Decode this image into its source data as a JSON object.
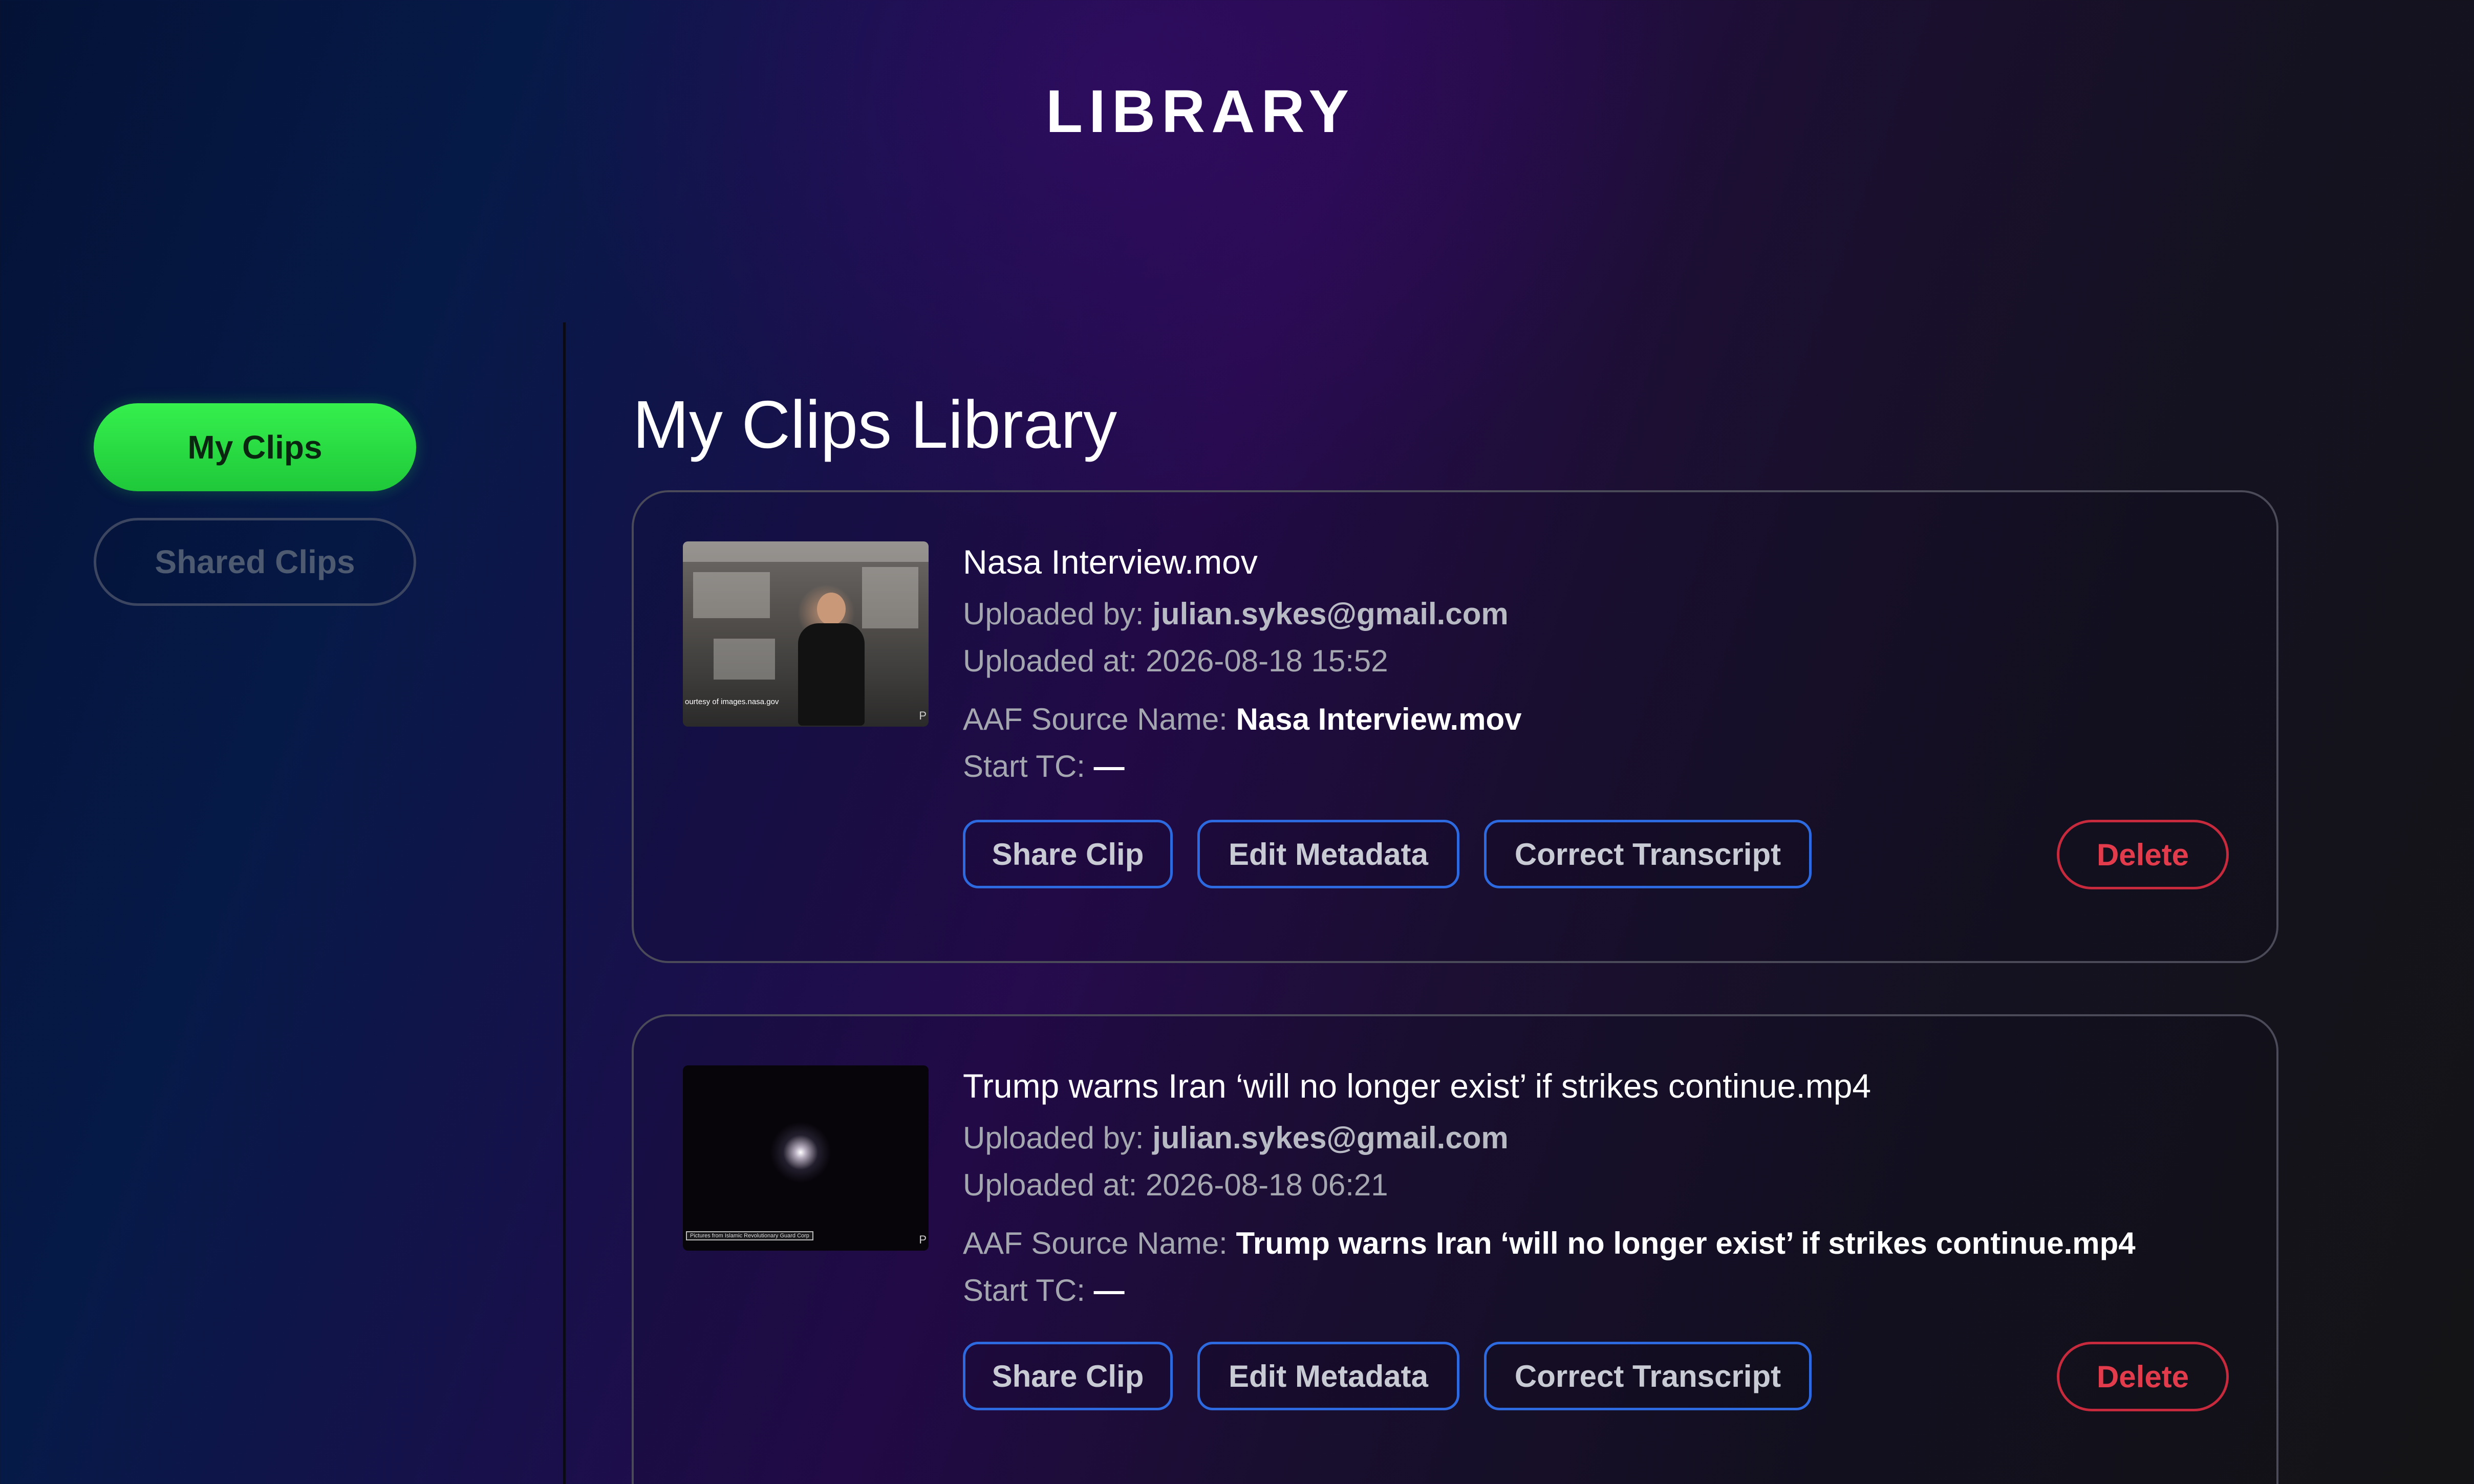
{
  "header": {
    "title": "LIBRARY"
  },
  "sidebar": {
    "items": [
      {
        "label": "My Clips",
        "active": true
      },
      {
        "label": "Shared Clips",
        "active": false
      }
    ]
  },
  "main": {
    "title": "My Clips Library",
    "clips": [
      {
        "title": "Nasa Interview.mov",
        "uploaded_by_label": "Uploaded by:",
        "uploaded_by": "julian.sykes@gmail.com",
        "uploaded_at_label": "Uploaded at:",
        "uploaded_at": "2026-08-18 15:52",
        "aaf_label": "AAF Source Name:",
        "aaf_source_name": "Nasa Interview.mov",
        "start_tc_label": "Start TC:",
        "start_tc": "—",
        "thumbnail_caption": "ourtesy of images.nasa.gov",
        "thumbnail_corner": "P"
      },
      {
        "title": "Trump warns Iran ‘will no longer exist’ if strikes continue.mp4",
        "uploaded_by_label": "Uploaded by:",
        "uploaded_by": "julian.sykes@gmail.com",
        "uploaded_at_label": "Uploaded at:",
        "uploaded_at": "2026-08-18 06:21",
        "aaf_label": "AAF Source Name:",
        "aaf_source_name": "Trump warns Iran ‘will no longer exist’ if strikes continue.mp4",
        "start_tc_label": "Start TC:",
        "start_tc": "—",
        "thumbnail_caption": "Pictures from Islamic Revolutionary Guard Corp",
        "thumbnail_corner": "P"
      }
    ],
    "actions": {
      "share": "Share Clip",
      "edit": "Edit Metadata",
      "correct": "Correct Transcript",
      "delete": "Delete"
    }
  },
  "colors": {
    "active_nav": "#2ee64a",
    "action_border": "#2d6ae0",
    "delete": "#e23b4c"
  }
}
